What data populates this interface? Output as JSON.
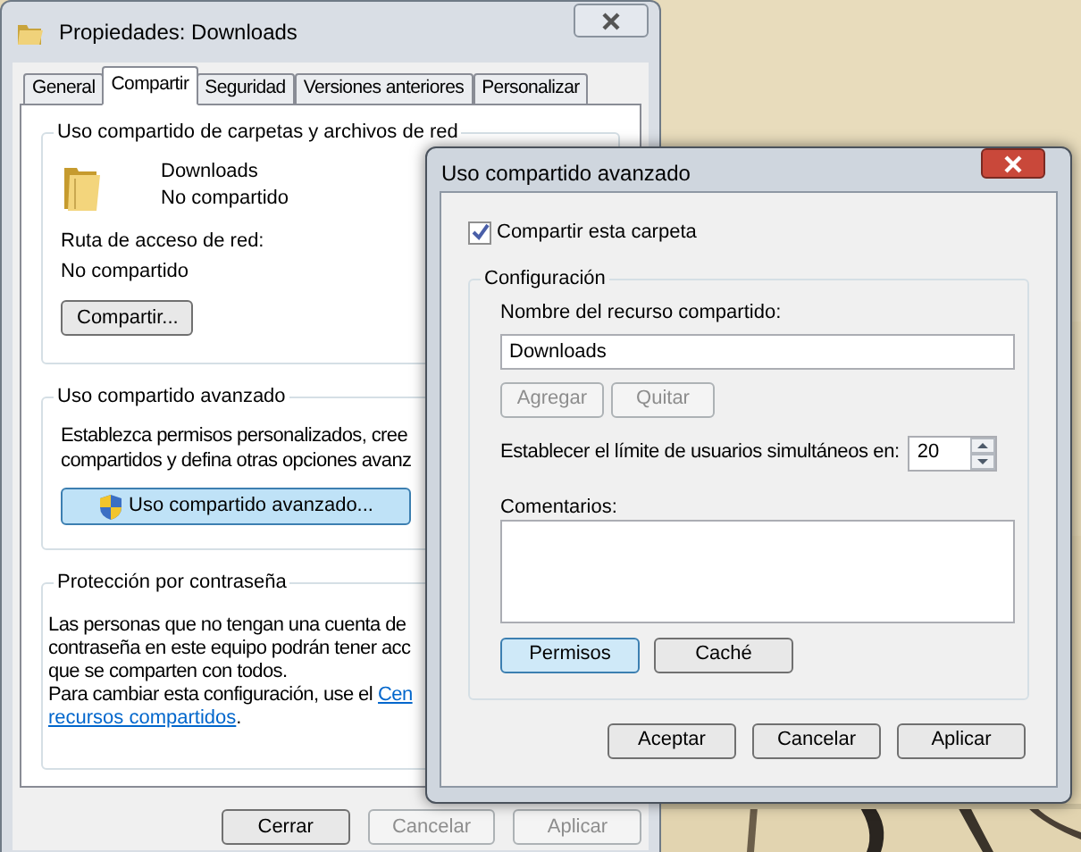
{
  "main_window": {
    "title": "Propiedades: Downloads",
    "tabs": [
      {
        "label": "General",
        "selected": false
      },
      {
        "label": "Compartir",
        "selected": true
      },
      {
        "label": "Seguridad",
        "selected": false
      },
      {
        "label": "Versiones anteriores",
        "selected": false
      },
      {
        "label": "Personalizar",
        "selected": false
      }
    ],
    "sharing_group": {
      "title": "Uso compartido de carpetas y archivos de red",
      "folder_name": "Downloads",
      "folder_status": "No compartido",
      "path_label": "Ruta de acceso de red:",
      "path_value": "No compartido",
      "button": "Compartir..."
    },
    "advanced_group": {
      "title": "Uso compartido avanzado",
      "description_lines": [
        "Establezca permisos personalizados, cree",
        "compartidos y defina otras opciones avanz"
      ],
      "button": "Uso compartido avanzado..."
    },
    "password_group": {
      "title": "Protección por contraseña",
      "lines": [
        "Las personas que no tengan una cuenta de",
        "contraseña en este equipo podrán tener acc",
        "que se comparten con todos."
      ],
      "change_text": "Para cambiar esta configuración, use el",
      "link_1": "Cen",
      "link_2": "recursos compartidos",
      "suffix": "."
    },
    "buttons": [
      {
        "label": "Cerrar",
        "disabled": false
      },
      {
        "label": "Cancelar",
        "disabled": true
      },
      {
        "label": "Aplicar",
        "disabled": true
      }
    ]
  },
  "dialog": {
    "title": "Uso compartido avanzado",
    "share_checkbox": {
      "label": "Compartir esta carpeta",
      "checked": true
    },
    "group_title": "Configuración",
    "share_name_label": "Nombre del recurso compartido:",
    "share_name_value": "Downloads",
    "name_buttons": [
      {
        "label": "Agregar",
        "disabled": true
      },
      {
        "label": "Quitar",
        "disabled": true
      }
    ],
    "user_limit_label": "Establecer el límite de usuarios simultáneos en:",
    "user_limit_value": "20",
    "comments_label": "Comentarios:",
    "group_buttons": [
      {
        "label": "Permisos",
        "focused": true
      },
      {
        "label": "Caché",
        "focused": false
      }
    ],
    "buttons": [
      {
        "label": "Aceptar"
      },
      {
        "label": "Cancelar"
      },
      {
        "label": "Aplicar"
      }
    ]
  }
}
